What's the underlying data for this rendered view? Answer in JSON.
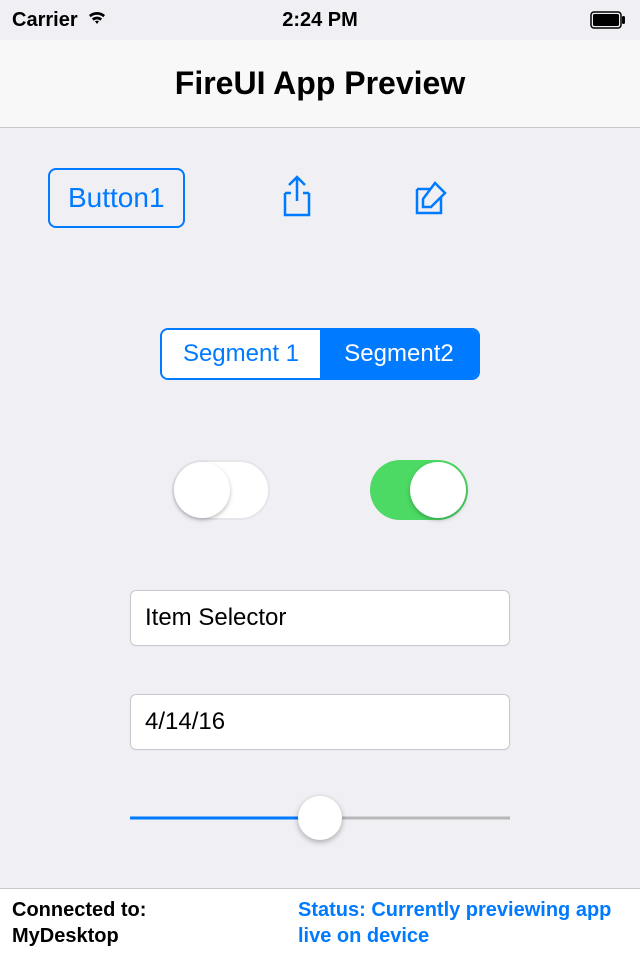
{
  "status_bar": {
    "carrier": "Carrier",
    "time": "2:24 PM"
  },
  "nav": {
    "title": "FireUI App Preview"
  },
  "toolbar": {
    "button1_label": "Button1"
  },
  "segments": {
    "items": [
      "Segment 1",
      "Segment2"
    ],
    "selected_index": 1
  },
  "switches": {
    "left_on": false,
    "right_on": true
  },
  "selector": {
    "label": "Item Selector"
  },
  "date_field": {
    "value": "4/14/16"
  },
  "slider": {
    "value_percent": 50
  },
  "footer": {
    "connected_label": "Connected to:",
    "connected_host": "MyDesktop",
    "status_text": "Status: Currently previewing app live on device"
  }
}
